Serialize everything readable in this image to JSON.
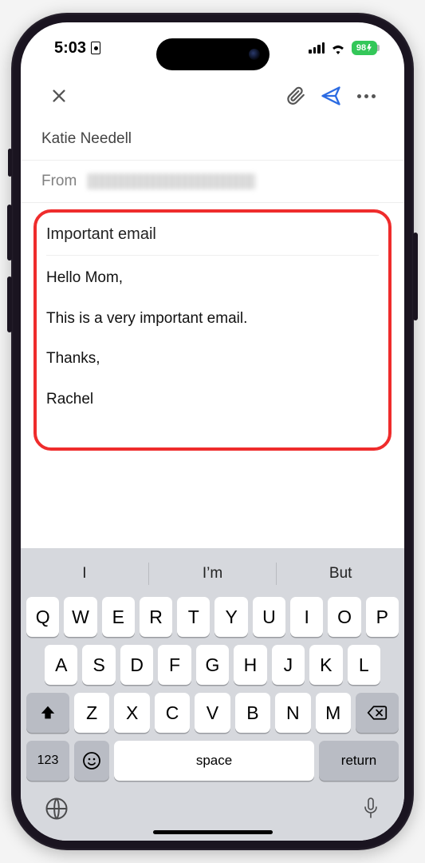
{
  "status": {
    "time": "5:03",
    "battery_pct": "98",
    "battery_charging": true
  },
  "toolbar": {
    "close_name": "close",
    "attach_name": "attach",
    "send_name": "send",
    "more_name": "more"
  },
  "compose": {
    "to_display": "Katie Needell",
    "from_label": "From",
    "subject": "Important email",
    "body_lines": [
      "Hello Mom,",
      "This is a very important email.",
      "Thanks,",
      "Rachel"
    ]
  },
  "keyboard": {
    "suggestions": [
      "I",
      "I’m",
      "But"
    ],
    "row1": [
      "Q",
      "W",
      "E",
      "R",
      "T",
      "Y",
      "U",
      "I",
      "O",
      "P"
    ],
    "row2": [
      "A",
      "S",
      "D",
      "F",
      "G",
      "H",
      "J",
      "K",
      "L"
    ],
    "row3": [
      "Z",
      "X",
      "C",
      "V",
      "B",
      "N",
      "M"
    ],
    "num_key": "123",
    "space_label": "space",
    "return_label": "return"
  }
}
